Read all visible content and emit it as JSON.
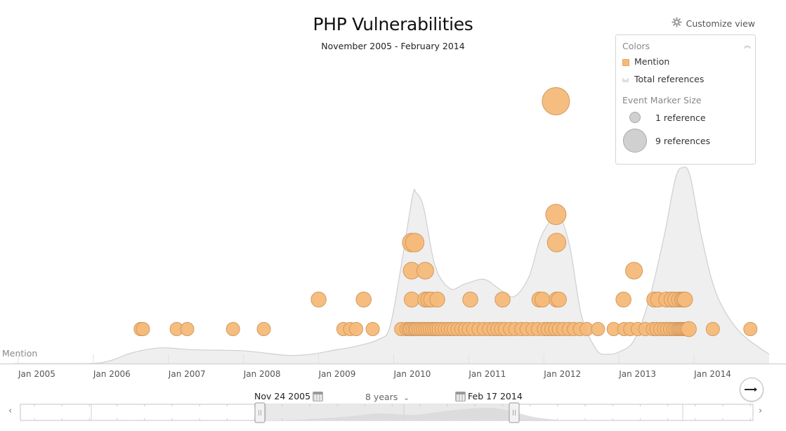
{
  "header": {
    "title": "PHP Vulnerabilities",
    "subtitle": "November 2005 - February 2014",
    "customize_label": "Customize view"
  },
  "legend": {
    "colors_heading": "Colors",
    "mention_label": "Mention",
    "total_label": "Total references",
    "size_heading": "Event Marker Size",
    "small_label": "1 reference",
    "big_label": "9 references"
  },
  "colors": {
    "mention": "#f5b97a",
    "mention_stroke": "#d39a5e",
    "total_area": "#efefef",
    "total_line": "#cfcfcf"
  },
  "row_label": "Mention",
  "range": {
    "start": "Nov 24 2005",
    "end": "Feb 17 2014",
    "span": "8 years",
    "span_chevron": "⌄"
  },
  "nav": {
    "left": "‹",
    "right": "›"
  },
  "chart_data": {
    "type": "scatter",
    "title": "PHP Vulnerabilities",
    "subtitle": "November 2005 - February 2014",
    "xlabel": "",
    "ylabel": "",
    "x_ticks": [
      "Jan 2005",
      "Jan 2006",
      "Jan 2007",
      "Jan 2008",
      "Jan 2009",
      "Jan 2010",
      "Jan 2011",
      "Jan 2012",
      "Jan 2013",
      "Jan 2014"
    ],
    "x_range": [
      2004.95,
      2015.0
    ],
    "series": [
      {
        "name": "Mention",
        "kind": "bubbles",
        "note": "x = fractional year, refs = references (marker size), stack = vertical stacking level",
        "points": [
          {
            "x": 2006.63,
            "refs": 1,
            "stack": 0
          },
          {
            "x": 2006.66,
            "refs": 1,
            "stack": 0
          },
          {
            "x": 2007.11,
            "refs": 1,
            "stack": 0
          },
          {
            "x": 2007.25,
            "refs": 1,
            "stack": 0
          },
          {
            "x": 2007.86,
            "refs": 1,
            "stack": 0
          },
          {
            "x": 2008.27,
            "refs": 1,
            "stack": 0
          },
          {
            "x": 2009.0,
            "refs": 2,
            "stack": 1
          },
          {
            "x": 2009.33,
            "refs": 1,
            "stack": 0
          },
          {
            "x": 2009.42,
            "refs": 1,
            "stack": 0
          },
          {
            "x": 2009.5,
            "refs": 1,
            "stack": 0
          },
          {
            "x": 2009.6,
            "refs": 2,
            "stack": 1
          },
          {
            "x": 2009.72,
            "refs": 1,
            "stack": 0
          },
          {
            "x": 2010.1,
            "refs": 1,
            "stack": 0
          },
          {
            "x": 2010.17,
            "refs": 1,
            "stack": 0
          },
          {
            "x": 2010.2,
            "refs": 1,
            "stack": 0
          },
          {
            "x": 2010.22,
            "refs": 1,
            "stack": 0
          },
          {
            "x": 2010.25,
            "refs": 1,
            "stack": 0
          },
          {
            "x": 2010.28,
            "refs": 1,
            "stack": 0
          },
          {
            "x": 2010.3,
            "refs": 1,
            "stack": 0
          },
          {
            "x": 2010.33,
            "refs": 1,
            "stack": 0
          },
          {
            "x": 2010.36,
            "refs": 1,
            "stack": 0
          },
          {
            "x": 2010.39,
            "refs": 1,
            "stack": 0
          },
          {
            "x": 2010.42,
            "refs": 1,
            "stack": 0
          },
          {
            "x": 2010.45,
            "refs": 1,
            "stack": 0
          },
          {
            "x": 2010.48,
            "refs": 1,
            "stack": 0
          },
          {
            "x": 2010.51,
            "refs": 1,
            "stack": 0
          },
          {
            "x": 2010.54,
            "refs": 1,
            "stack": 0
          },
          {
            "x": 2010.57,
            "refs": 1,
            "stack": 0
          },
          {
            "x": 2010.6,
            "refs": 1,
            "stack": 0
          },
          {
            "x": 2010.64,
            "refs": 1,
            "stack": 0
          },
          {
            "x": 2010.68,
            "refs": 1,
            "stack": 0
          },
          {
            "x": 2010.72,
            "refs": 1,
            "stack": 0
          },
          {
            "x": 2010.76,
            "refs": 1,
            "stack": 0
          },
          {
            "x": 2010.8,
            "refs": 1,
            "stack": 0
          },
          {
            "x": 2010.85,
            "refs": 1,
            "stack": 0
          },
          {
            "x": 2010.9,
            "refs": 1,
            "stack": 0
          },
          {
            "x": 2010.95,
            "refs": 1,
            "stack": 0
          },
          {
            "x": 2011.0,
            "refs": 1,
            "stack": 0
          },
          {
            "x": 2011.06,
            "refs": 1,
            "stack": 0
          },
          {
            "x": 2011.13,
            "refs": 1,
            "stack": 0
          },
          {
            "x": 2011.2,
            "refs": 1,
            "stack": 0
          },
          {
            "x": 2011.27,
            "refs": 1,
            "stack": 0
          },
          {
            "x": 2011.33,
            "refs": 1,
            "stack": 0
          },
          {
            "x": 2011.38,
            "refs": 1,
            "stack": 0
          },
          {
            "x": 2011.43,
            "refs": 1,
            "stack": 0
          },
          {
            "x": 2011.48,
            "refs": 1,
            "stack": 0
          },
          {
            "x": 2011.55,
            "refs": 1,
            "stack": 0
          },
          {
            "x": 2011.62,
            "refs": 1,
            "stack": 0
          },
          {
            "x": 2011.7,
            "refs": 1,
            "stack": 0
          },
          {
            "x": 2011.77,
            "refs": 1,
            "stack": 0
          },
          {
            "x": 2011.85,
            "refs": 1,
            "stack": 0
          },
          {
            "x": 2011.92,
            "refs": 1,
            "stack": 0
          },
          {
            "x": 2012.0,
            "refs": 1,
            "stack": 0
          },
          {
            "x": 2012.05,
            "refs": 1,
            "stack": 0
          },
          {
            "x": 2012.1,
            "refs": 1,
            "stack": 0
          },
          {
            "x": 2012.15,
            "refs": 1,
            "stack": 0
          },
          {
            "x": 2012.2,
            "refs": 1,
            "stack": 0
          },
          {
            "x": 2012.26,
            "refs": 1,
            "stack": 0
          },
          {
            "x": 2012.33,
            "refs": 1,
            "stack": 0
          },
          {
            "x": 2012.4,
            "refs": 1,
            "stack": 0
          },
          {
            "x": 2012.48,
            "refs": 1,
            "stack": 0
          },
          {
            "x": 2012.57,
            "refs": 1,
            "stack": 0
          },
          {
            "x": 2012.72,
            "refs": 1,
            "stack": 0
          },
          {
            "x": 2012.93,
            "refs": 1,
            "stack": 0
          },
          {
            "x": 2013.07,
            "refs": 1,
            "stack": 0
          },
          {
            "x": 2013.15,
            "refs": 1,
            "stack": 0
          },
          {
            "x": 2013.25,
            "refs": 1,
            "stack": 0
          },
          {
            "x": 2013.35,
            "refs": 1,
            "stack": 0
          },
          {
            "x": 2013.45,
            "refs": 1,
            "stack": 0
          },
          {
            "x": 2013.5,
            "refs": 1,
            "stack": 0
          },
          {
            "x": 2013.55,
            "refs": 1,
            "stack": 0
          },
          {
            "x": 2013.6,
            "refs": 1,
            "stack": 0
          },
          {
            "x": 2013.64,
            "refs": 1,
            "stack": 0
          },
          {
            "x": 2013.68,
            "refs": 1,
            "stack": 0
          },
          {
            "x": 2013.72,
            "refs": 1,
            "stack": 0
          },
          {
            "x": 2013.75,
            "refs": 1,
            "stack": 0
          },
          {
            "x": 2013.78,
            "refs": 1,
            "stack": 0
          },
          {
            "x": 2013.8,
            "refs": 1,
            "stack": 0
          },
          {
            "x": 2013.82,
            "refs": 1,
            "stack": 0
          },
          {
            "x": 2013.84,
            "refs": 1,
            "stack": 0
          },
          {
            "x": 2013.86,
            "refs": 1,
            "stack": 0
          },
          {
            "x": 2013.88,
            "refs": 1,
            "stack": 0
          },
          {
            "x": 2013.9,
            "refs": 1,
            "stack": 0
          },
          {
            "x": 2013.93,
            "refs": 2,
            "stack": 0
          },
          {
            "x": 2014.25,
            "refs": 1,
            "stack": 0
          },
          {
            "x": 2014.75,
            "refs": 1,
            "stack": 0
          },
          {
            "x": 2010.24,
            "refs": 2,
            "stack": 1
          },
          {
            "x": 2010.42,
            "refs": 2,
            "stack": 1
          },
          {
            "x": 2010.46,
            "refs": 2,
            "stack": 1
          },
          {
            "x": 2010.5,
            "refs": 2,
            "stack": 1
          },
          {
            "x": 2010.58,
            "refs": 2,
            "stack": 1
          },
          {
            "x": 2011.02,
            "refs": 2,
            "stack": 1
          },
          {
            "x": 2011.45,
            "refs": 2,
            "stack": 1
          },
          {
            "x": 2011.94,
            "refs": 2,
            "stack": 1
          },
          {
            "x": 2011.98,
            "refs": 2,
            "stack": 1
          },
          {
            "x": 2012.17,
            "refs": 2,
            "stack": 1
          },
          {
            "x": 2012.2,
            "refs": 2,
            "stack": 1
          },
          {
            "x": 2013.06,
            "refs": 2,
            "stack": 1
          },
          {
            "x": 2013.47,
            "refs": 2,
            "stack": 1
          },
          {
            "x": 2013.52,
            "refs": 2,
            "stack": 1
          },
          {
            "x": 2013.63,
            "refs": 2,
            "stack": 1
          },
          {
            "x": 2013.7,
            "refs": 2,
            "stack": 1
          },
          {
            "x": 2013.75,
            "refs": 2,
            "stack": 1
          },
          {
            "x": 2013.8,
            "refs": 2,
            "stack": 1
          },
          {
            "x": 2013.84,
            "refs": 2,
            "stack": 1
          },
          {
            "x": 2013.86,
            "refs": 2,
            "stack": 1
          },
          {
            "x": 2013.88,
            "refs": 2,
            "stack": 1
          },
          {
            "x": 2010.24,
            "refs": 3,
            "stack": 2
          },
          {
            "x": 2010.42,
            "refs": 3,
            "stack": 2
          },
          {
            "x": 2013.2,
            "refs": 3,
            "stack": 2
          },
          {
            "x": 2010.24,
            "refs": 4,
            "stack": 3
          },
          {
            "x": 2010.28,
            "refs": 4,
            "stack": 3
          },
          {
            "x": 2012.17,
            "refs": 4,
            "stack": 3
          },
          {
            "x": 2012.16,
            "refs": 5,
            "stack": 4
          },
          {
            "x": 2012.16,
            "refs": 9,
            "stack": 5
          }
        ]
      },
      {
        "name": "Total references",
        "kind": "area",
        "x": [
          2004.95,
          2005.9,
          2006.2,
          2006.5,
          2006.8,
          2007.0,
          2007.3,
          2007.7,
          2008.0,
          2008.3,
          2008.6,
          2008.9,
          2009.2,
          2009.5,
          2009.8,
          2009.95,
          2010.1,
          2010.25,
          2010.3,
          2010.4,
          2010.55,
          2010.75,
          2010.95,
          2011.2,
          2011.4,
          2011.6,
          2011.8,
          2011.95,
          2012.1,
          2012.2,
          2012.35,
          2012.5,
          2012.7,
          2012.85,
          2013.0,
          2013.2,
          2013.4,
          2013.6,
          2013.75,
          2013.85,
          2013.95,
          2014.1,
          2014.3,
          2014.6,
          2015.0
        ],
        "y": [
          0,
          0,
          0.2,
          0.9,
          1.3,
          1.35,
          1.2,
          1.15,
          1.1,
          0.9,
          0.7,
          0.8,
          1.15,
          1.5,
          2.1,
          3.2,
          8.5,
          14.5,
          14.8,
          13.5,
          8.5,
          6.5,
          6.9,
          7.3,
          6.5,
          5.8,
          7.5,
          10.8,
          12.5,
          13.0,
          10.0,
          4.2,
          1.2,
          0.8,
          1.0,
          2.0,
          5.5,
          11.0,
          16.0,
          17.0,
          16.2,
          11.0,
          6.0,
          2.8,
          0.8
        ]
      }
    ],
    "legend": [
      "Mention",
      "Total references"
    ],
    "legend_position": "top-right",
    "grid": false
  }
}
